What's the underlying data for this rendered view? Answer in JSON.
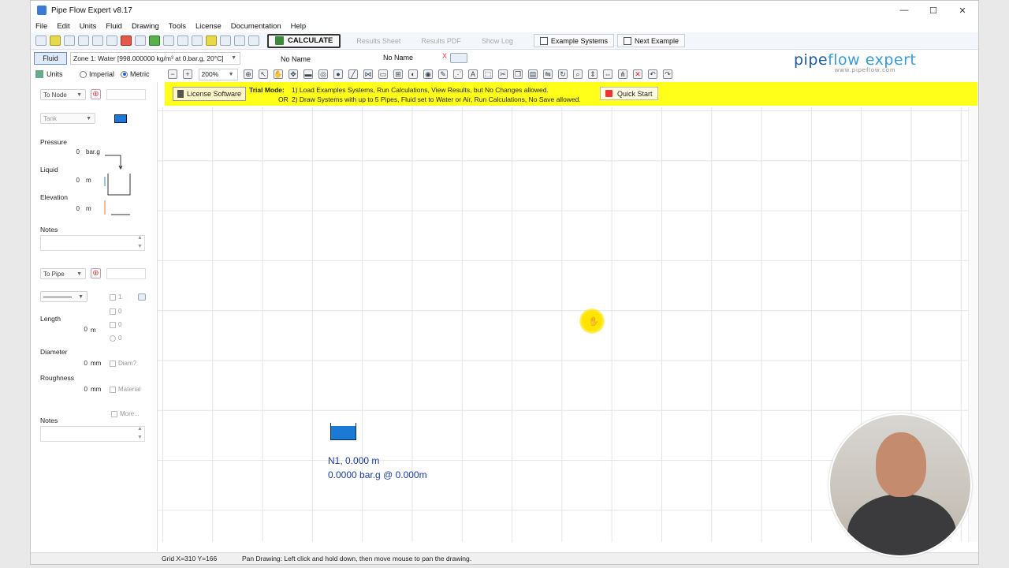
{
  "window": {
    "title": "Pipe Flow Expert v8.17",
    "minimize": "—",
    "maximize": "☐",
    "close": "✕"
  },
  "menu": [
    "File",
    "Edit",
    "Units",
    "Fluid",
    "Drawing",
    "Tools",
    "License",
    "Documentation",
    "Help"
  ],
  "toolbar": {
    "calculate": "CALCULATE",
    "results_sheet": "Results Sheet",
    "results_pdf": "Results PDF",
    "show_log": "Show Log",
    "example_systems": "Example Systems",
    "next_example": "Next Example"
  },
  "fluid": {
    "button": "Fluid",
    "zone": "Zone 1: Water [998.000000 kg/m³ at 0.bar.g, 20°C]",
    "name1": "No Name",
    "name2": "No Name",
    "close": "X"
  },
  "brand": {
    "name_a": "pipe",
    "name_b": "flow",
    "name_c": " expert",
    "url": "www.pipeflow.com"
  },
  "units": {
    "button": "Units",
    "imperial": "Imperial",
    "metric": "Metric",
    "selected": "Metric",
    "zoom": "200%"
  },
  "trial": {
    "license_btn": "License Software",
    "label": "Trial Mode:",
    "line1": "1) Load Examples Systems, Run Calculations, View Results, but No Changes allowed.",
    "or": "OR",
    "line2": "2) Draw Systems with up to 5 Pipes, Fluid set to Water or Air, Run Calculations, No Save allowed.",
    "quick_start": "Quick Start"
  },
  "node_panel": {
    "to_node": "To Node",
    "type": "Tank",
    "pressure_label": "Pressure",
    "pressure_val": "0",
    "pressure_unit": "bar.g",
    "liquid_label": "Liquid",
    "liquid_val": "0",
    "liquid_unit": "m",
    "elev_label": "Elevation",
    "elev_val": "0",
    "elev_unit": "m",
    "notes_label": "Notes"
  },
  "pipe_panel": {
    "to_pipe": "To Pipe",
    "count1": "1",
    "count2": "0",
    "count3": "0",
    "count4": "0",
    "length_label": "Length",
    "length_val": "0",
    "length_unit": "m",
    "diam_label": "Diameter",
    "diam_val": "0",
    "diam_unit": "mm",
    "diam_btn": "Diam?",
    "rough_label": "Roughness",
    "rough_val": "0",
    "rough_unit": "mm",
    "material_btn": "Material",
    "more_btn": "More...",
    "notes_label": "Notes"
  },
  "canvas": {
    "node_line1": "N1, 0.000 m",
    "node_line2": "0.0000 bar.g @ 0.000m"
  },
  "status": {
    "grid": "Grid X=310 Y=166",
    "message": "Pan Drawing: Left click and hold down, then move mouse to pan the drawing."
  },
  "colors": {
    "trial_bar": "#ffff1a",
    "tank": "#1a7ad6",
    "node_text": "#1a3a9a"
  }
}
